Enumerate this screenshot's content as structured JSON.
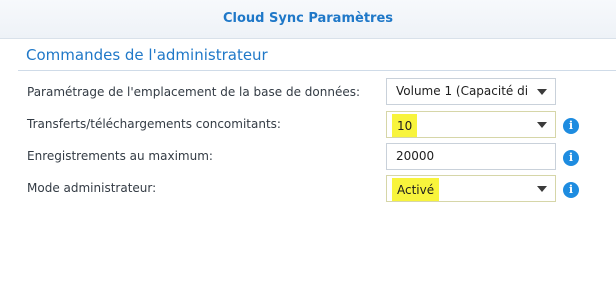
{
  "window": {
    "title": "Cloud Sync Paramètres"
  },
  "section": {
    "title": "Commandes de l'administrateur"
  },
  "rows": [
    {
      "label": "Paramétrage de l'emplacement de la base de données:",
      "value": "Volume 1 (Capacité di",
      "control": "select",
      "highlighted": false,
      "info_icon": false
    },
    {
      "label": "Transferts/téléchargements concomitants:",
      "value": "10",
      "control": "select",
      "highlighted": true,
      "info_icon": true
    },
    {
      "label": "Enregistrements au maximum:",
      "value": "20000",
      "control": "text-input",
      "highlighted": false,
      "info_icon": true
    },
    {
      "label": "Mode administrateur:",
      "value": "Activé",
      "control": "select",
      "highlighted": true,
      "info_icon": true
    }
  ],
  "icons": {
    "info": "info-icon",
    "dropdown": "chevron-down-icon"
  },
  "info_glyph": "i",
  "colors": {
    "accent": "#1f78c8",
    "info": "#1e8ce0",
    "highlight": "#f8f43c"
  }
}
